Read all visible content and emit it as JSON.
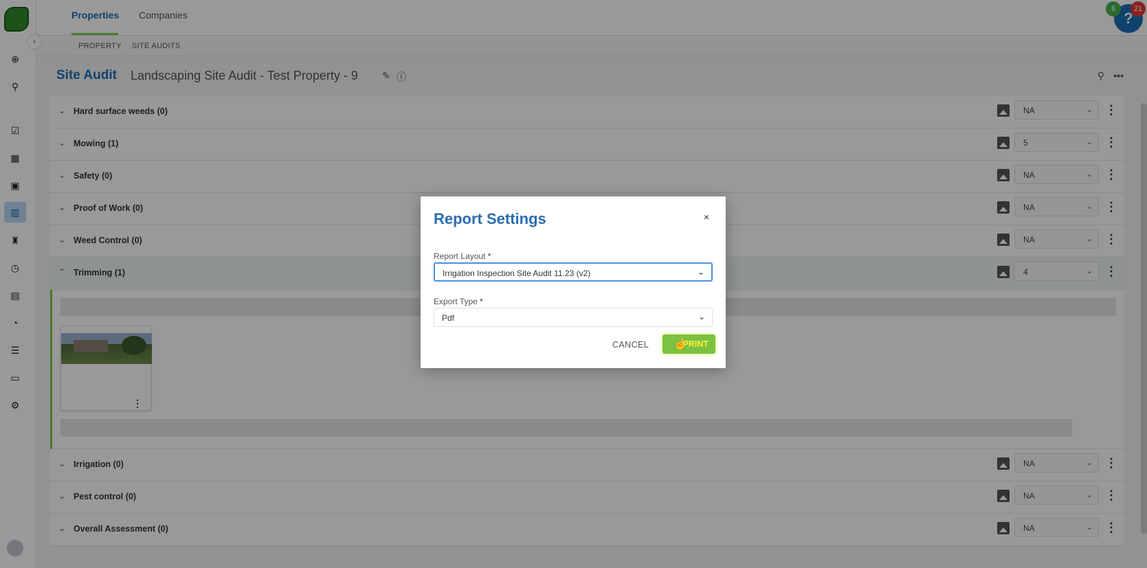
{
  "top_tabs": [
    {
      "label": "Properties",
      "active": true
    },
    {
      "label": "Companies",
      "active": false
    }
  ],
  "notifications": {
    "green_count": "8",
    "red_count": "21",
    "help_label": "?"
  },
  "subnav": [
    "PROPERTY",
    "SITE AUDITS"
  ],
  "page": {
    "title": "Site Audit",
    "subtitle": "Landscaping Site Audit - Test Property - 9"
  },
  "sections": [
    {
      "label": "Hard surface weeds (0)",
      "value": "NA"
    },
    {
      "label": "Mowing (1)",
      "value": "5"
    },
    {
      "label": "Safety (0)",
      "value": "NA"
    },
    {
      "label": "Proof of Work (0)",
      "value": "NA"
    },
    {
      "label": "Weed Control (0)",
      "value": "NA"
    },
    {
      "label": "Trimming (1)",
      "value": "4"
    },
    {
      "label": "Irrigation (0)",
      "value": "NA"
    },
    {
      "label": "Pest control (0)",
      "value": "NA"
    },
    {
      "label": "Overall Assessment (0)",
      "value": "NA"
    }
  ],
  "modal": {
    "title": "Report Settings",
    "close_label": "×",
    "layout_label": "Report Layout",
    "layout_value": "Irrigation Inspection Site Audit 11.23 (v2)",
    "export_label": "Export Type",
    "export_value": "Pdf",
    "required_mark": "*",
    "cancel_label": "CANCEL",
    "print_label": "PRINT"
  },
  "colors": {
    "brand_blue": "#1b6fb8",
    "accent_green": "#7ac943",
    "print_button": "#7cc242"
  }
}
